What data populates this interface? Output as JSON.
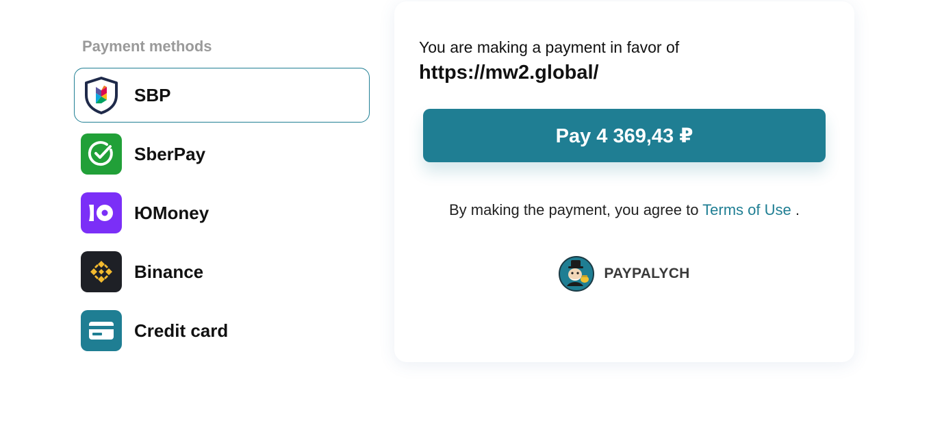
{
  "payment_methods": {
    "title": "Payment methods",
    "items": [
      {
        "label": "SBP",
        "icon": "sbp-icon",
        "color": "#1f2a4a",
        "selected": true
      },
      {
        "label": "SberPay",
        "icon": "sberpay-icon",
        "color": "#21a038",
        "selected": false
      },
      {
        "label": "ЮMoney",
        "icon": "yoomoney-icon",
        "color": "#7b2ff7",
        "selected": false
      },
      {
        "label": "Binance",
        "icon": "binance-icon",
        "color": "#1e2026",
        "selected": false
      },
      {
        "label": "Credit card",
        "icon": "credit-card-icon",
        "color": "#1f7e93",
        "selected": false
      }
    ]
  },
  "payment": {
    "favor_text": "You are making a payment in favor of",
    "recipient_url": "https://mw2.global/",
    "pay_button_label": "Pay 4 369,43 ₽",
    "agree_prefix": "By making the payment, you agree to",
    "terms_link": "Terms of Use",
    "agree_suffix": "."
  },
  "brand": {
    "name": "PAYPALYCH",
    "icon": "paypalych-mascot-icon"
  },
  "colors": {
    "accent": "#1f7e93",
    "muted_text": "#9a9a9a"
  }
}
